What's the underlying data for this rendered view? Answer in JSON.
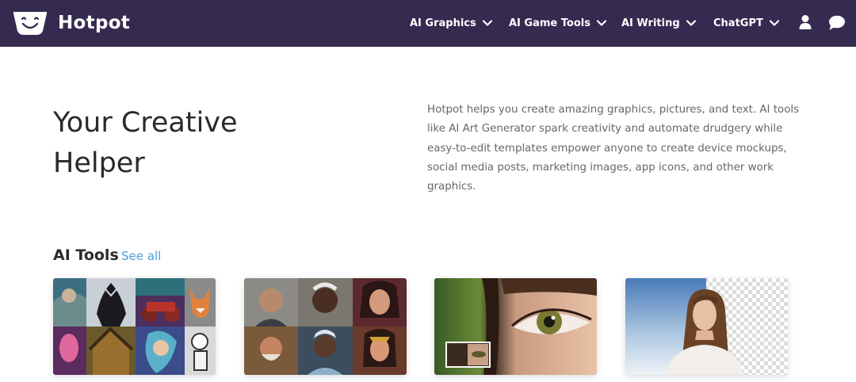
{
  "brand": {
    "name": "Hotpot"
  },
  "nav": {
    "items": [
      {
        "label": "AI Graphics"
      },
      {
        "label": "AI Game Tools"
      },
      {
        "label": "AI Writing"
      },
      {
        "label": "ChatGPT"
      }
    ],
    "icons": [
      "user-icon",
      "chat-icon"
    ]
  },
  "hero": {
    "title": "Your Creative Helper",
    "description": "Hotpot helps you create amazing graphics, pictures, and text. AI tools like AI Art Generator spark creativity and automate drudgery while easy-to-edit templates empower anyone to create device mockups, social media posts, marketing images, app icons, and other work graphics."
  },
  "tools": {
    "heading": "AI Tools",
    "see_all": "See all"
  },
  "colors": {
    "nav_bg": "#352a4f",
    "link": "#4a9fd6",
    "heading": "#2a2a2a",
    "body_text": "#666666"
  }
}
